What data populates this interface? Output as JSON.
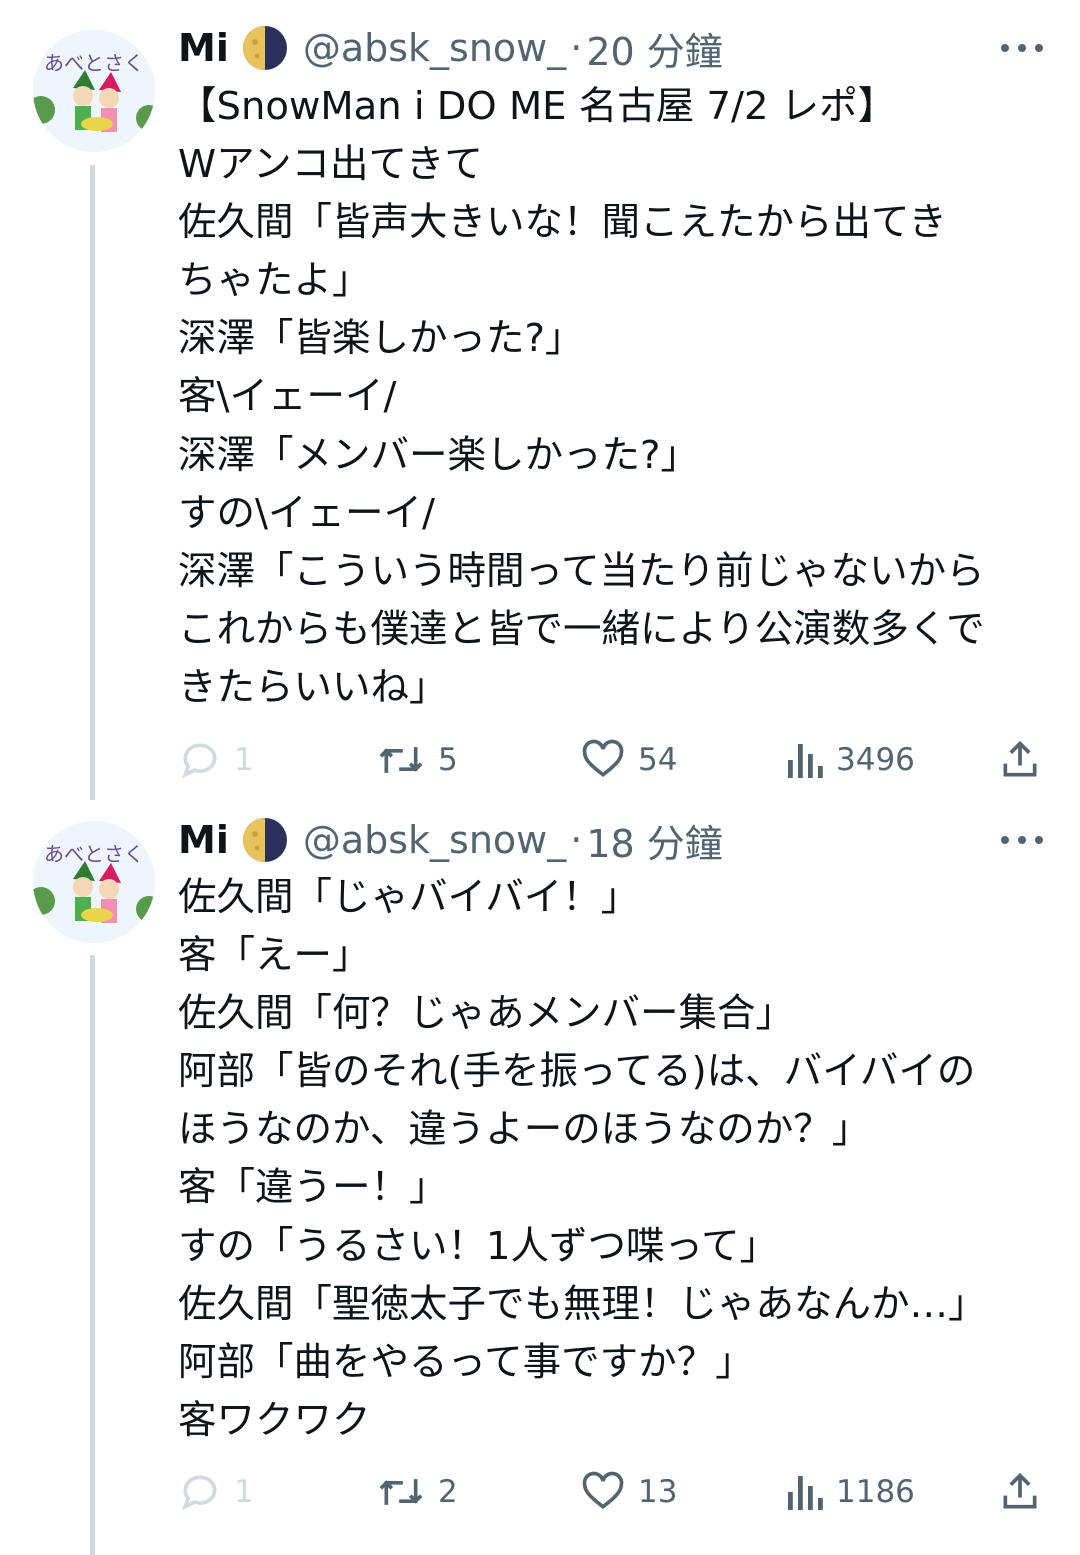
{
  "tweets": [
    {
      "avatar_text": "あべとさく",
      "name": "Mi",
      "handle": "@absk_snow_",
      "separator": "·",
      "time": "20 分鐘",
      "body": "【SnowMan i DO ME 名古屋 7/2 レポ】\nWアンコ出てきて\n佐久間「皆声大きいな！聞こえたから出てき\nちゃたよ」\n深澤「皆楽しかった?」\n客\\イェーイ/\n深澤「メンバー楽しかった?」\nすの\\イェーイ/\n深澤「こういう時間って当たり前じゃないから\nこれからも僕達と皆で一緒により公演数多くで\nきたらいいね」",
      "stats": {
        "replies": "1",
        "retweets": "5",
        "likes": "54",
        "views": "3496"
      }
    },
    {
      "avatar_text": "あべとさく",
      "name": "Mi",
      "handle": "@absk_snow_",
      "separator": "·",
      "time": "18 分鐘",
      "body": "佐久間「じゃバイバイ！」\n客「えー」\n佐久間「何？じゃあメンバー集合」\n阿部「皆のそれ(手を振ってる)は、バイバイの\nほうなのか、違うよーのほうなのか？」\n客「違うー！」\nすの「うるさい！1人ずつ喋って」\n佐久間「聖徳太子でも無理！じゃあなんか…」\n阿部「曲をやるって事ですか？」\n客ワクワク",
      "stats": {
        "replies": "1",
        "retweets": "2",
        "likes": "13",
        "views": "1186"
      }
    }
  ],
  "icons": [
    "more-icon",
    "reply-icon",
    "retweet-icon",
    "like-icon",
    "views-icon",
    "share-icon",
    "moon-emoji-icon"
  ],
  "colors": {
    "text": "#0f1419",
    "secondary": "#536471",
    "thread_line": "#cfd9de",
    "muted": "#cfd9de"
  }
}
